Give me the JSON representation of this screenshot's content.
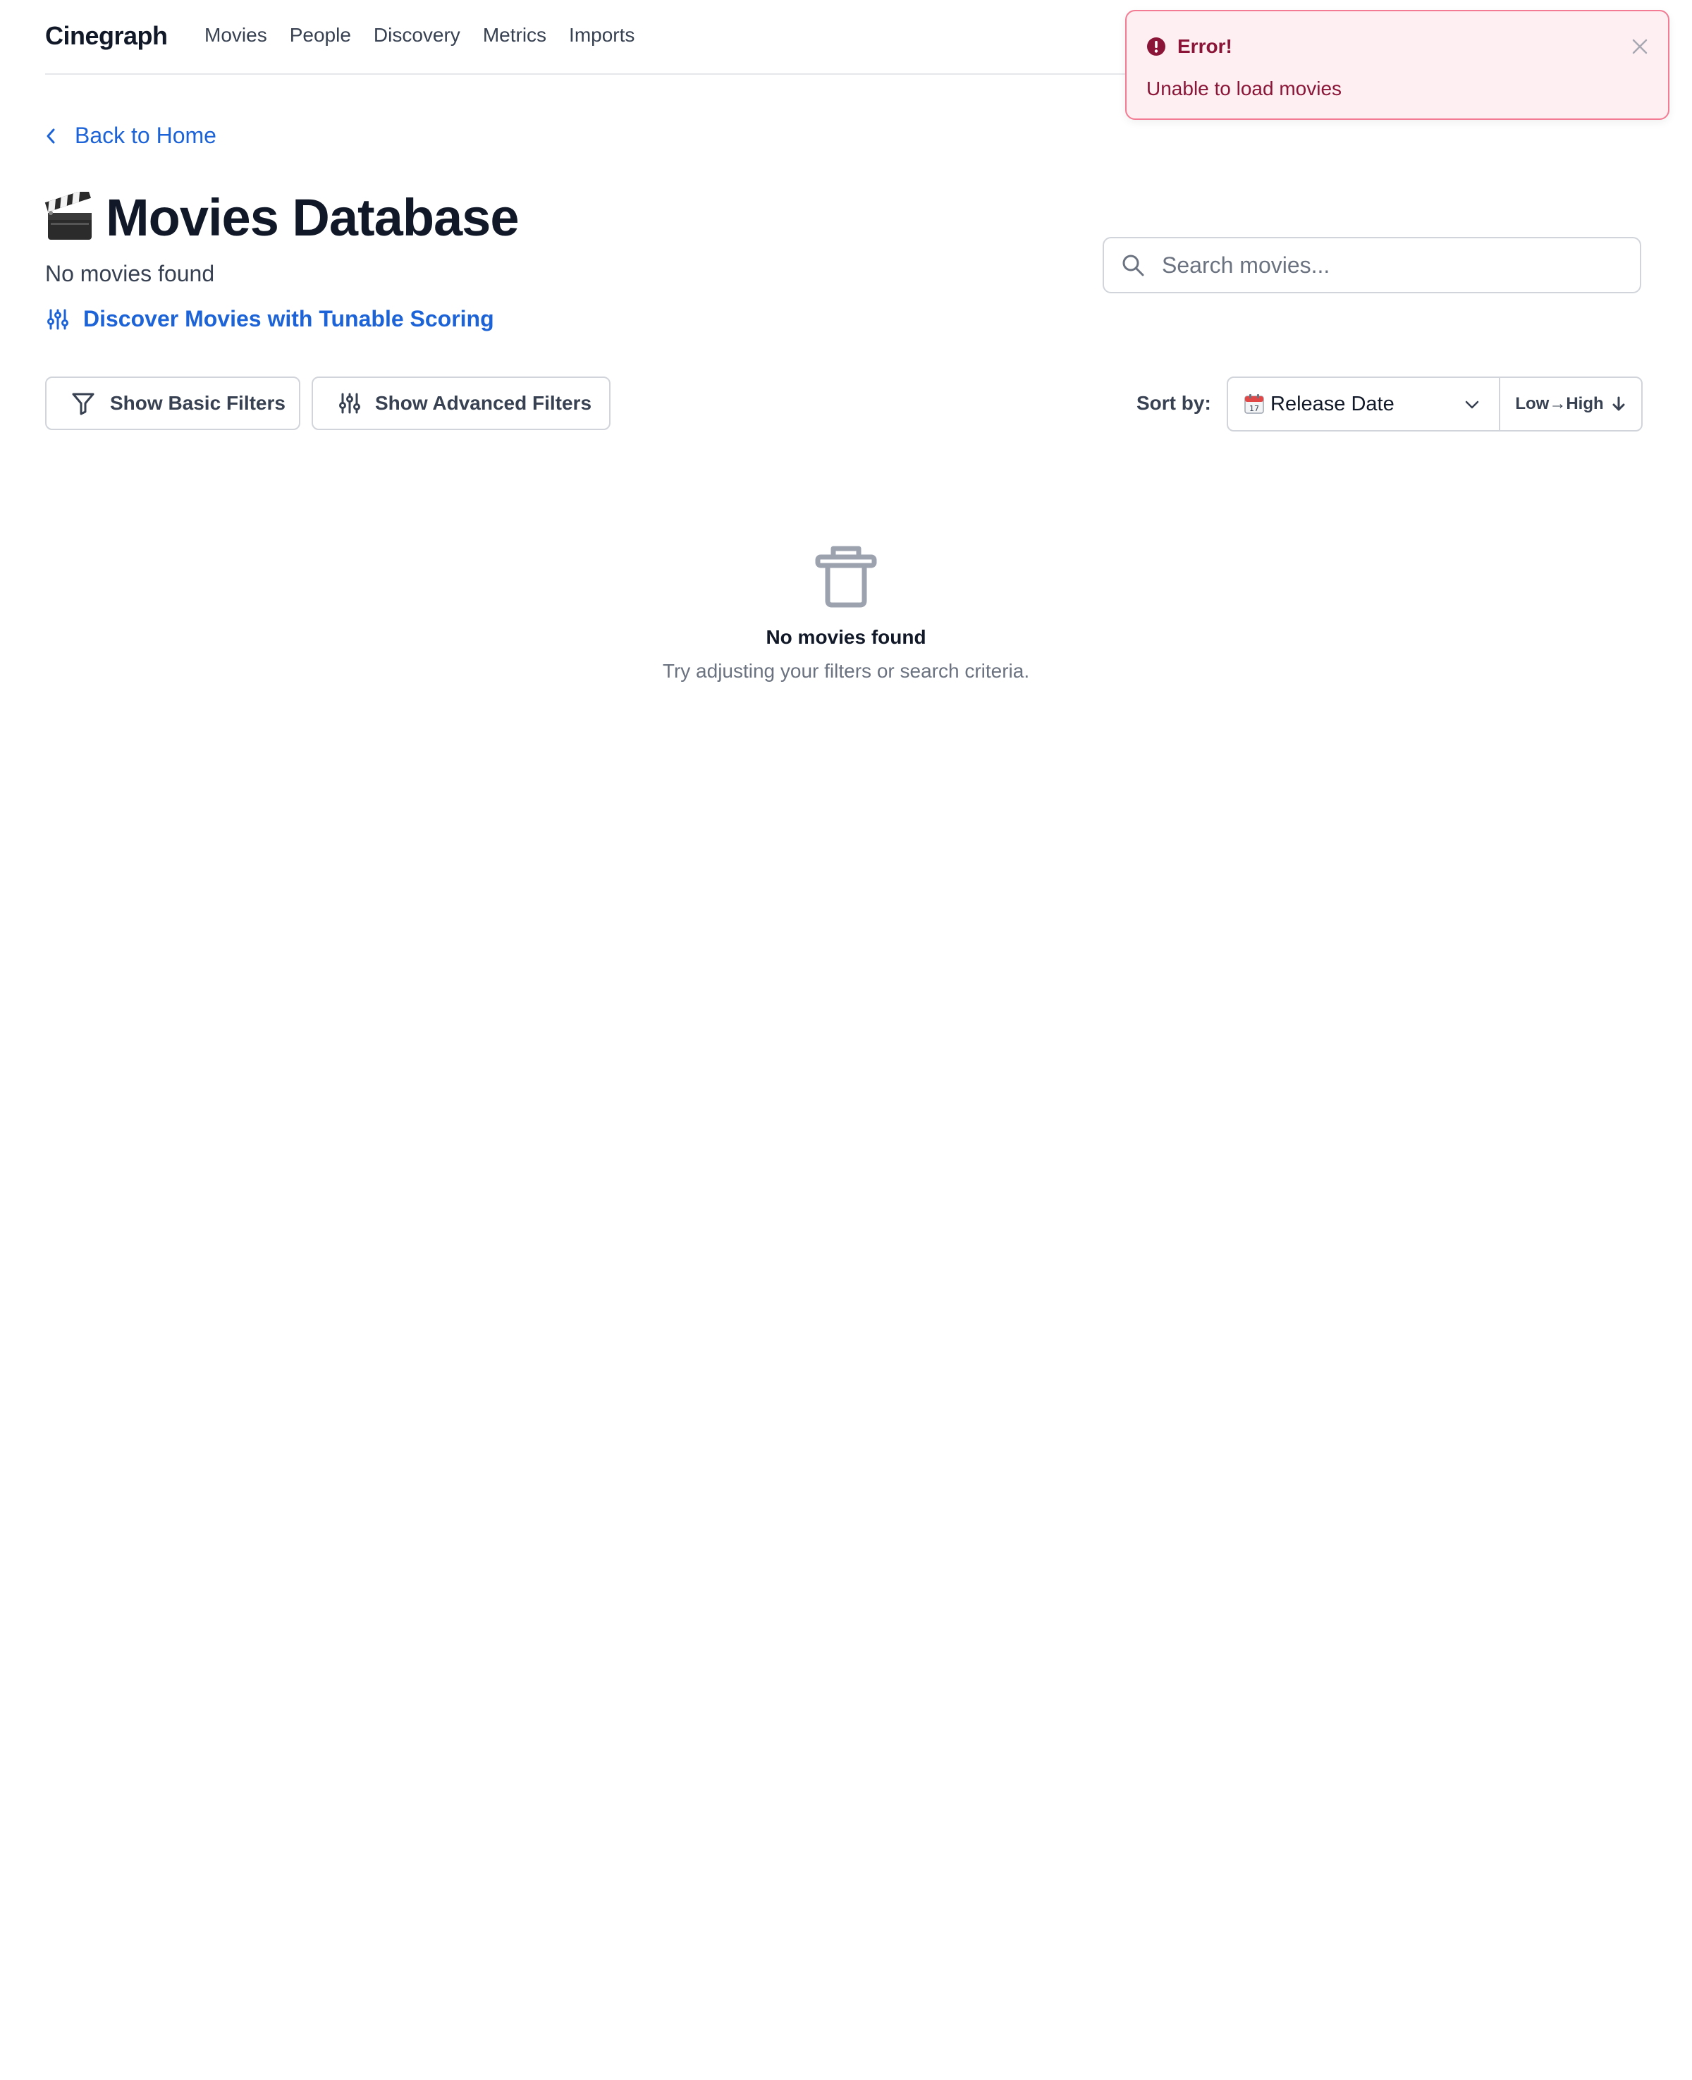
{
  "nav": {
    "brand": "Cinegraph",
    "links": [
      "Movies",
      "People",
      "Discovery",
      "Metrics",
      "Imports"
    ]
  },
  "back_link": {
    "label": "Back to Home",
    "icon": "chevron-left-icon"
  },
  "header": {
    "emoji_icon": "clapper-board-icon",
    "title": "Movies Database",
    "count_text": "No movies found",
    "discover_link": "Discover Movies with Tunable Scoring"
  },
  "search": {
    "placeholder": "Search movies...",
    "value": ""
  },
  "filters": {
    "basic_label": "Show Basic Filters",
    "advanced_label": "Show Advanced Filters"
  },
  "sort": {
    "label": "Sort by:",
    "selected": "Release Date",
    "selected_icon": "calendar-icon",
    "direction": "Low→High"
  },
  "empty_state": {
    "icon": "trash-icon",
    "title": "No movies found",
    "subtitle": "Try adjusting your filters or search criteria."
  },
  "toast": {
    "title": "Error!",
    "message": "Unable to load movies",
    "icon": "alert-circle-icon"
  },
  "colors": {
    "link": "#1d63d8",
    "toast_bg": "#fef0f2",
    "toast_border": "#f37c94",
    "toast_text": "#8b1538",
    "muted": "#6b7280"
  }
}
